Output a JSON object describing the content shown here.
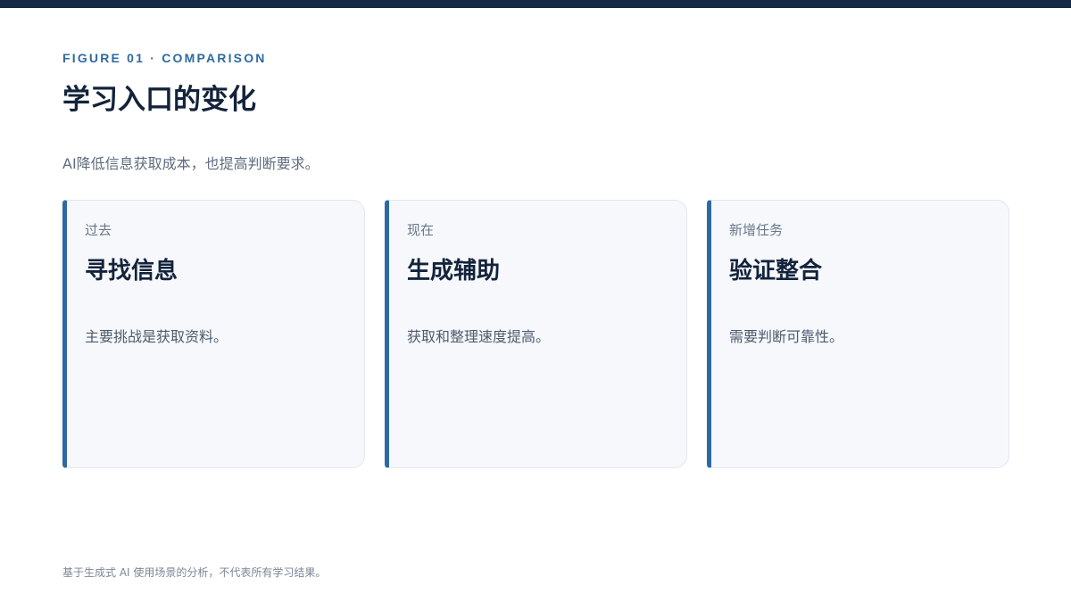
{
  "header": {
    "eyebrow": "FIGURE 01 · COMPARISON",
    "title": "学习入口的变化",
    "subtitle": "AI降低信息获取成本，也提高判断要求。"
  },
  "cards": [
    {
      "kicker": "过去",
      "heading": "寻找信息",
      "body": "主要挑战是获取资料。"
    },
    {
      "kicker": "现在",
      "heading": "生成辅助",
      "body": "获取和整理速度提高。"
    },
    {
      "kicker": "新增任务",
      "heading": "验证整合",
      "body": "需要判断可靠性。"
    }
  ],
  "footer": {
    "note": "基于生成式 AI 使用场景的分析，不代表所有学习结果。"
  },
  "colors": {
    "top_bar": "#152a45",
    "accent": "#2d6aa2",
    "card_background": "#f6f8fc"
  }
}
